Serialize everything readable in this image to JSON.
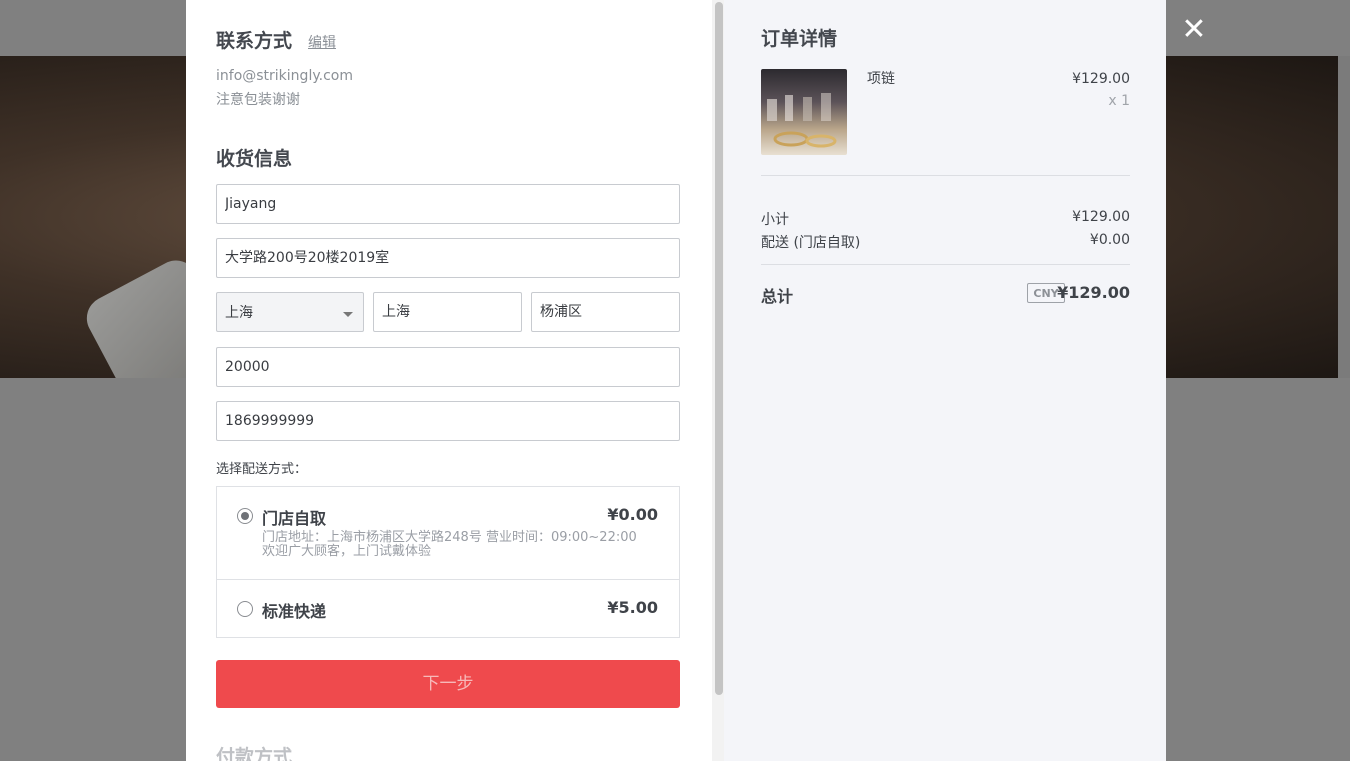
{
  "close_icon": "close-icon",
  "contact": {
    "title": "联系方式",
    "edit_label": "编辑",
    "email": "info@strikingly.com",
    "note": "注意包装谢谢"
  },
  "shipping": {
    "title": "收货信息",
    "name": "Jiayang",
    "address": "大学路200号20楼2019室",
    "province": "上海",
    "city": "上海",
    "district": "杨浦区",
    "postal_code": "20000",
    "phone": "1869999999",
    "method_label": "选择配送方式：",
    "options": [
      {
        "name": "门店自取",
        "price": "¥0.00",
        "selected": true,
        "desc_line1": "门店地址：上海市杨浦区大学路248号 营业时间：09:00~22:00",
        "desc_line2": "欢迎广大顾客，上门试戴体验"
      },
      {
        "name": "标准快递",
        "price": "¥5.00",
        "selected": false
      }
    ]
  },
  "next_button": "下一步",
  "payment_title": "付款方式",
  "order": {
    "title": "订单详情",
    "item": {
      "name": "项链",
      "price": "¥129.00",
      "qty": "x 1"
    },
    "subtotal_label": "小计",
    "subtotal_value": "¥129.00",
    "delivery_label": "配送 (门店自取)",
    "delivery_value": "¥0.00",
    "total_label": "总计",
    "currency": "CNY",
    "total_value": "¥129.00"
  },
  "colors": {
    "accent": "#ef4a4d",
    "right_panel_bg": "#f4f5f9"
  }
}
